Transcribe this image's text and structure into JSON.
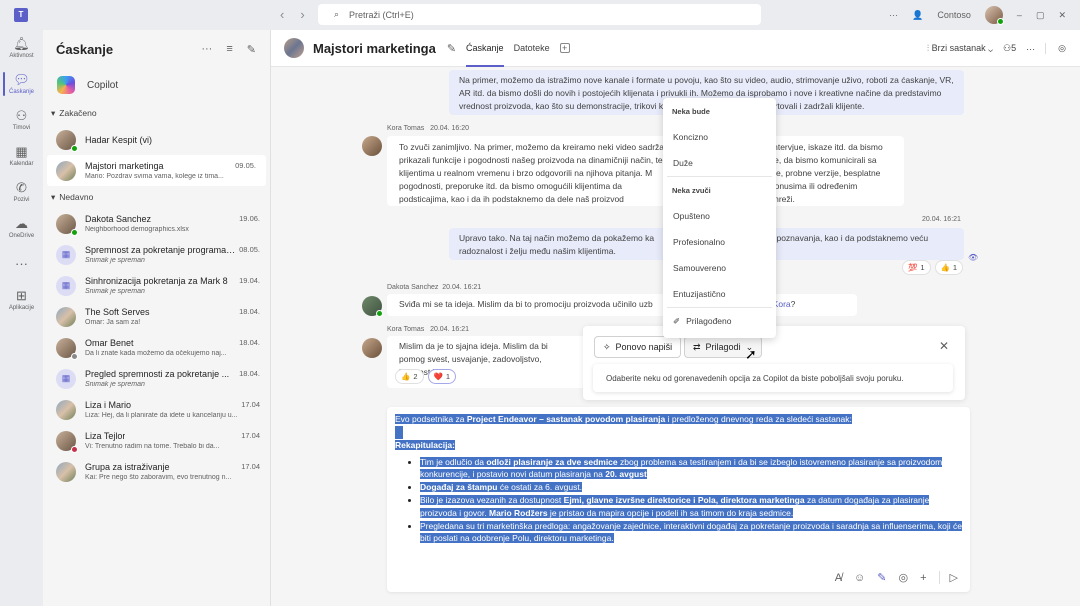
{
  "titlebar": {
    "search_placeholder": "Pretraži (Ctrl+E)",
    "org": "Contoso",
    "more": "···",
    "minimize": "–",
    "restore": "▢",
    "close": "✕"
  },
  "rail": {
    "items": [
      {
        "label": "Aktivnost",
        "icon": "bell-icon"
      },
      {
        "label": "Ćaskanje",
        "icon": "chat-icon"
      },
      {
        "label": "Timovi",
        "icon": "teams-icon"
      },
      {
        "label": "Kalendar",
        "icon": "calendar-icon"
      },
      {
        "label": "Pozivi",
        "icon": "phone-icon"
      },
      {
        "label": "OneDrive",
        "icon": "cloud-icon"
      },
      {
        "label": "···",
        "icon": "more-icon"
      },
      {
        "label": "Aplikacije",
        "icon": "apps-icon"
      }
    ]
  },
  "chatlist": {
    "title": "Ćaskanje",
    "copilot": "Copilot",
    "pinned_label": "Zakačeno",
    "recent_label": "Nedavno",
    "pinned": [
      {
        "name": "Hadar Kespit (vi)",
        "date": "",
        "preview": ""
      },
      {
        "name": "Majstori marketinga",
        "date": "09.05.",
        "preview": "Mario: Pozdrav svima vama, kolege iz tima..."
      }
    ],
    "recent": [
      {
        "name": "Dakota Sanchez",
        "date": "19.06.",
        "preview": "Neighborhood demographics.xlsx"
      },
      {
        "name": "Spremnost za pokretanje programa ...",
        "date": "08.05.",
        "preview": "Snimak je spreman"
      },
      {
        "name": "Sinhronizacija pokretanja za Mark 8",
        "date": "19.04.",
        "preview": "Snimak je spreman"
      },
      {
        "name": "The Soft Serves",
        "date": "18.04.",
        "preview": "Omar: Ja sam za!"
      },
      {
        "name": "Omar Benet",
        "date": "18.04.",
        "preview": "Da li znate kada možemo da očekujemo naj..."
      },
      {
        "name": "Pregled spremnosti za pokretanje ...",
        "date": "18.04.",
        "preview": "Snimak je spreman"
      },
      {
        "name": "Liza i Mario",
        "date": "17.04",
        "preview": "Liza: Hej, da li planirate da idete u kancelariju u..."
      },
      {
        "name": "Liza Tejlor",
        "date": "17.04",
        "preview": "Vi: Trenutno radim na tome. Trebalo bi da..."
      },
      {
        "name": "Grupa za istraživanje",
        "date": "17.04",
        "preview": "Kai: Pre nego što zaboravim, evo trenutnog n..."
      }
    ]
  },
  "header": {
    "title": "Majstori marketinga",
    "tabs": [
      "Ćaskanje",
      "Datoteke"
    ],
    "meet_now": "Brzi sastanak",
    "participants": "5"
  },
  "messages": {
    "m1": "Na primer, možemo da istražimo nove kanale i formate u povoju, kao što su video, audio, strimovanje uživo, roboti za ćaskanje, VR, AR itd. da bismo došli do novih i postojećih klijenata i privukli ih. Možemo da isprobamo i nove i kreativne načine da predstavimo vrednost proizvoda, kao što su demonstracije, trikovi kao što su iskustva u ob                                convertovali i zadržali klijente.",
    "m2_author": "Kora Tomas",
    "m2_time": "20.04. 16:20",
    "m2": "To zvuči zanimljivo. Na primer, možemo da kreiramo neki video sadržaj k                                    va, intervjue, iskaze itd. da bismo prikazali funkcije i pogodnosti našeg proizvoda na dinamičniji način, te s                                    skanje, da bismo komunicirali sa klijentima u realnom vremenu i brzo odgovorili na njihova pitanja. M                                    monstracije, probne verzije, besplatne pogodnosti, preporuke itd. da bismo omogućili klijentima da                                    od, sa dodatnim bonusima ili određenim podsticajima, kao i da ih podstaknemo da dele naš proizvod                                    m krugovima na mreži.",
    "m3_time": "20.04. 16:21",
    "m3": "Upravo tako. Na taj način možemo da pokažemo ka                                    i vredan upoznavanja, kao i da podstaknemo veću radoznalost i želju među našim klijentima.",
    "m3_reactions": [
      {
        "emoji": "💯",
        "count": "1"
      },
      {
        "emoji": "👍",
        "count": "1"
      }
    ],
    "m4_author": "Dakota Sanchez",
    "m4_time": "20.04. 16:21",
    "m4": "Sviđa mi se ta ideja. Mislim da bi to promociju proizvoda učinilo uzb                                    vi mislite ",
    "m4_mention": "Kora",
    "m5_author": "Kora Tomas",
    "m5_time": "20.04. 16:21",
    "m5": "Mislim da je to sjajna ideja. Mislim da bi pomog svest, usvajanje, zadovoljstvo, lojalnost i",
    "m5_reactions": [
      {
        "emoji": "👍",
        "count": "2"
      },
      {
        "emoji": "❤️",
        "count": "1"
      }
    ]
  },
  "tone_menu": {
    "length_header": "Neka bude",
    "length": [
      "Koncizno",
      "Duže"
    ],
    "tone_header": "Neka zvuči",
    "tone": [
      "Opušteno",
      "Profesionalno",
      "Samouvereno",
      "Entuzijastično"
    ],
    "custom": "Prilagođeno"
  },
  "copilot_panel": {
    "rewrite": "Ponovo napiši",
    "adjust": "Prilagodi",
    "hint": "Odaberite neku od gorenavedenih opcija za Copilot da biste poboljšali svoju poruku."
  },
  "compose": {
    "intro_a": "Evo podsetnika za ",
    "intro_b": "Project Endeavor – sastanak povodom plasiranja",
    "intro_c": " i predloženog dnevnog reda za sledeći sastanak:",
    "recap": "Rekapitulacija:",
    "b1_a": "Tim je odlučio da ",
    "b1_b": "odloži plasiranje za dve sedmice",
    "b1_c": " zbog problema sa testiranjem i da bi se izbeglo istovremeno plasiranje sa proizvodom konkurencije, i postavio novi datum plasiranja na ",
    "b1_d": "20. avgust",
    "b2_a": "Događaj za štampu",
    "b2_b": " će ostati za 6. avgust.",
    "b3_a": "Bilo je izazova vezanih za dostupnost ",
    "b3_b": "Ejmi, glavne izvršne direktorice i Pola, direktora marketinga",
    "b3_c": " za datum događaja za plasiranje proizvoda i govor. ",
    "b3_d": "Mario Rodžers",
    "b3_e": " je pristao da mapira opcije i podeli ih sa timom do kraja sedmice.",
    "b4": "Pregledana su tri marketinška predloga: angažovanje zajednice, interaktivni događaj za pokretanje proizvoda i saradnja sa influenserima, koji će biti poslati na odobrenje Polu, direktoru marketinga."
  },
  "colors": {
    "accent": "#5b5fc7",
    "selection": "#4472c4",
    "my_bubble": "#e8ebfa"
  }
}
